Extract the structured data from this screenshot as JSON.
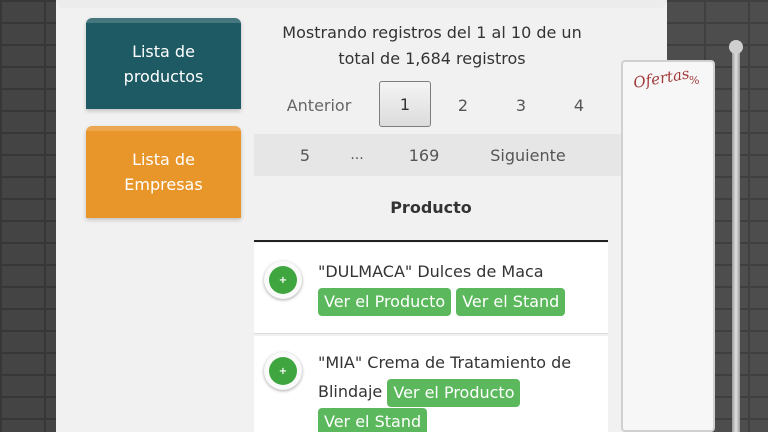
{
  "sidebar": {
    "products_tab": "Lista de\nproductos",
    "companies_tab": "Lista de\nEmpresas"
  },
  "info": {
    "text": "Mostrando registros del 1 al 10 de un total de 1,684 registros"
  },
  "pagination": {
    "prev": "Anterior",
    "pages_row1": [
      "1",
      "2",
      "3",
      "4"
    ],
    "pages_row2": [
      "5",
      "...",
      "169"
    ],
    "next": "Siguiente",
    "current": "1"
  },
  "table": {
    "header": "Producto",
    "rows": [
      {
        "name": "\"DULMACA\" Dulces de Maca",
        "view_product": "Ver el Producto",
        "view_stand": "Ver el Stand"
      },
      {
        "name": "\"MIA\" Crema de Tratamiento de Blindaje",
        "view_product": "Ver el Producto",
        "view_stand": "Ver el Stand"
      }
    ],
    "expand_icon": "+"
  },
  "offers_panel": {
    "title": "Ofertas",
    "percent": "%"
  },
  "colors": {
    "products_tab": "#1e5a63",
    "companies_tab": "#e8952a",
    "action_button": "#5cb85c"
  }
}
